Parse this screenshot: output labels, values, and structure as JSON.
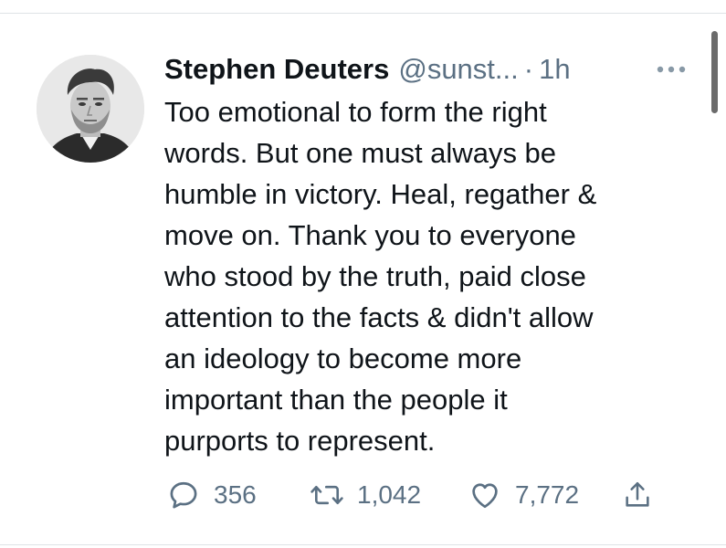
{
  "tweet": {
    "display_name": "Stephen Deuters",
    "handle": "@sunst...",
    "separator": "·",
    "time": "1h",
    "text": "Too emotional to form the right\nwords. But one must always be\nhumble in victory. Heal, regather &\nmove on. Thank you to everyone\nwho stood by the truth, paid close\nattention to the facts & didn't allow\nan ideology to become more\nimportant than the people it\npurports to represent.",
    "more_icon": "ellipsis-icon",
    "avatar": "profile-photo"
  },
  "actions": {
    "reply": {
      "icon": "reply-icon",
      "count": "356"
    },
    "retweet": {
      "icon": "retweet-icon",
      "count": "1,042"
    },
    "like": {
      "icon": "heart-icon",
      "count": "7,772"
    },
    "share": {
      "icon": "share-icon"
    }
  },
  "colors": {
    "text": "#0f1419",
    "secondary": "#5b7083",
    "divider": "#dfe3e6"
  }
}
